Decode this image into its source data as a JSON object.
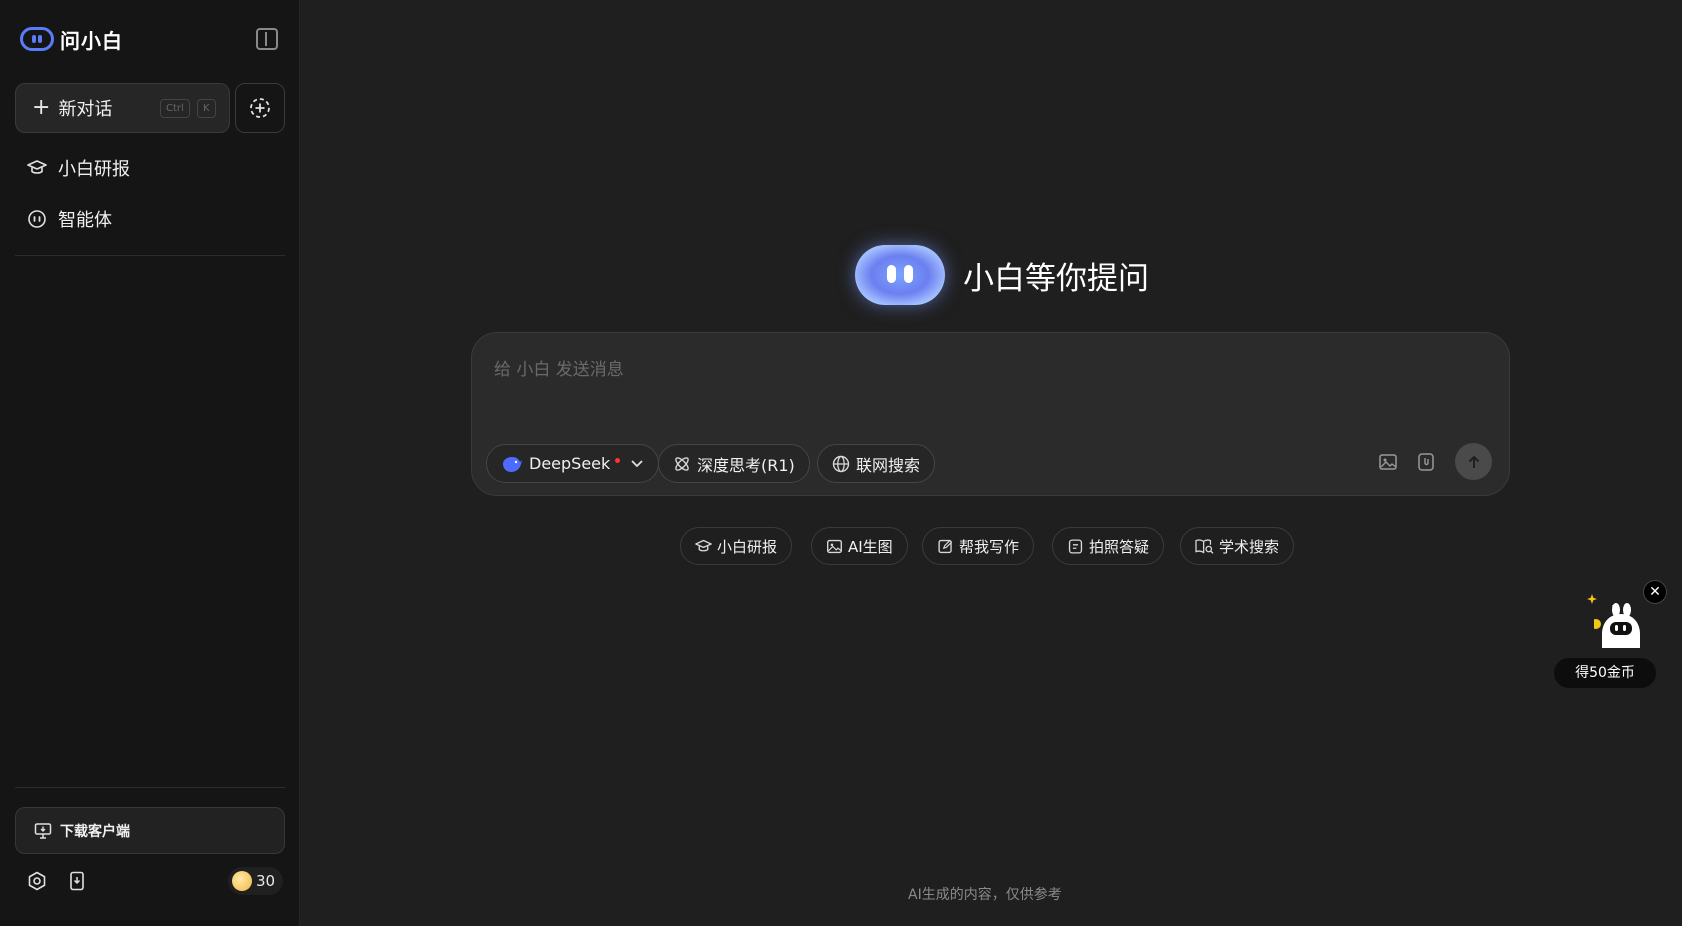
{
  "sidebar": {
    "brand": "问小白",
    "new_chat": {
      "label": "新对话",
      "kbd_ctrl": "Ctrl",
      "kbd_key": "K"
    },
    "nav": [
      {
        "label": "小白研报",
        "icon": "graduation-cap-icon"
      },
      {
        "label": "智能体",
        "icon": "bot-face-icon"
      }
    ],
    "download_label": "下载客户端",
    "coins": "30"
  },
  "main": {
    "hero_title": "小白等你提问",
    "composer": {
      "placeholder": "给 小白 发送消息",
      "model": "DeepSeek",
      "deep_think": "深度思考(R1)",
      "web_search": "联网搜索"
    },
    "quick_actions": [
      {
        "label": "小白研报",
        "icon": "graduation-cap-icon"
      },
      {
        "label": "AI生图",
        "icon": "image-icon"
      },
      {
        "label": "帮我写作",
        "icon": "edit-icon"
      },
      {
        "label": "拍照答疑",
        "icon": "note-icon"
      },
      {
        "label": "学术搜索",
        "icon": "book-search-icon"
      }
    ],
    "footer_note": "AI生成的内容，仅供参考"
  },
  "promo": {
    "label": "得50金币",
    "close": "✕"
  },
  "colors": {
    "accent": "#5b7cfa",
    "background": "#1f1f1f",
    "sidebar": "#151515",
    "alert": "#ff3333"
  }
}
